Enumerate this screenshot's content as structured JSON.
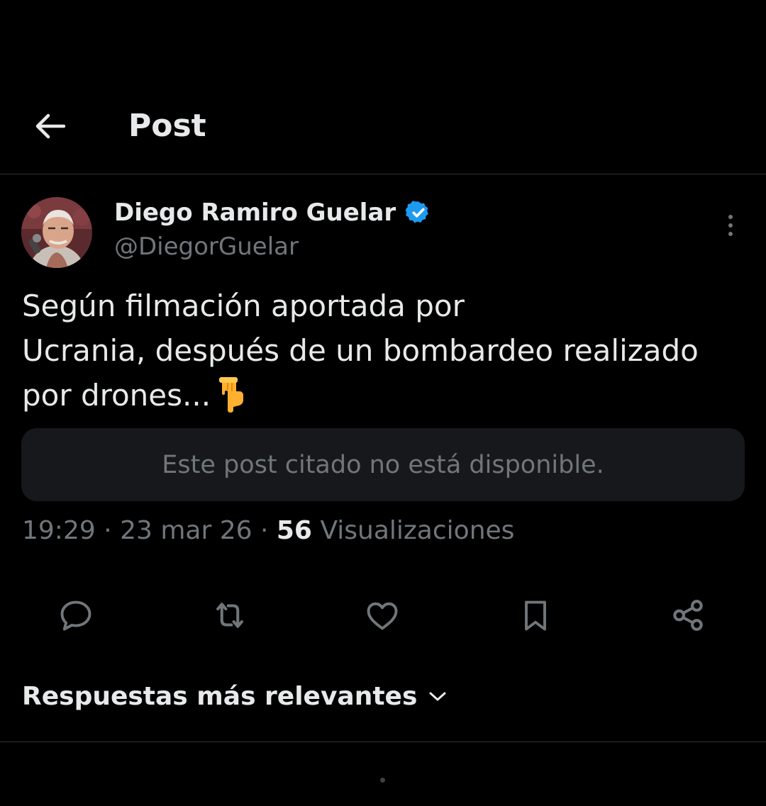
{
  "header": {
    "title": "Post",
    "back_icon": "arrow-left-icon"
  },
  "post": {
    "author": {
      "name": "Diego Ramiro Guelar",
      "handle": "@DiegorGuelar",
      "verified_color": "#1d9bf0"
    },
    "text_lines": [
      "Según filmación aportada por",
      "Ucrania, después de un bombardeo realizado",
      "por drones..."
    ],
    "text_emoji": "pointing-down-hand-emoji",
    "quote_unavailable": "Este post citado no está disponible.",
    "time": "19:29",
    "separator": " · ",
    "date": "23 mar 26",
    "views_count": "56",
    "views_label": "Visualizaciones"
  },
  "actions": [
    "reply-icon",
    "repost-icon",
    "like-icon",
    "bookmark-icon",
    "share-icon"
  ],
  "sort": {
    "label": "Respuestas más relevantes",
    "icon": "chevron-down-icon"
  },
  "colors": {
    "background": "#000000",
    "text": "#e7e9ea",
    "muted": "#71767b",
    "accent": "#1d9bf0"
  }
}
